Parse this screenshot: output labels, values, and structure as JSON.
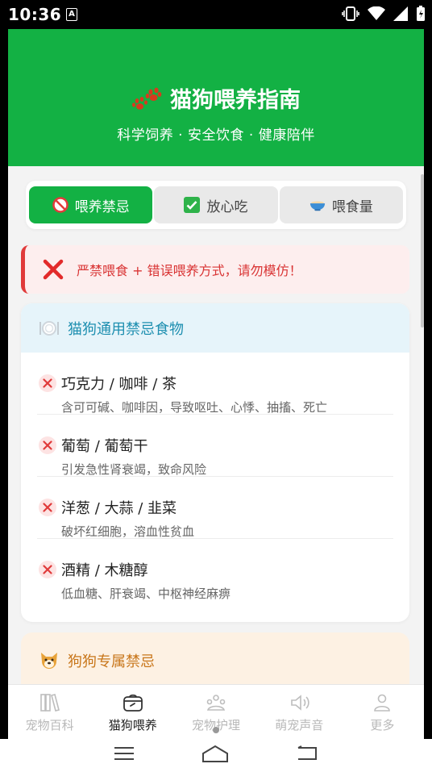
{
  "status": {
    "time": "10:36",
    "notif_letter": "A"
  },
  "header": {
    "title": "猫狗喂养指南",
    "subtitle": "科学饲养 · 安全饮食 · 健康陪伴"
  },
  "tabs": [
    {
      "label": "喂养禁忌",
      "icon": "prohibited-icon",
      "active": true
    },
    {
      "label": "放心吃",
      "icon": "check-box-icon",
      "active": false
    },
    {
      "label": "喂食量",
      "icon": "bowl-icon",
      "active": false
    }
  ],
  "warning": {
    "text": "严禁喂食 + 错误喂养方式，请勿模仿！"
  },
  "card": {
    "title": "猫狗通用禁忌食物",
    "items": [
      {
        "title": "巧克力 / 咖啡 / 茶",
        "desc": "含可可碱、咖啡因，导致呕吐、心悸、抽搐、死亡"
      },
      {
        "title": "葡萄 / 葡萄干",
        "desc": "引发急性肾衰竭，致命风险"
      },
      {
        "title": "洋葱 / 大蒜 / 韭菜",
        "desc": "破坏红细胞，溶血性贫血"
      },
      {
        "title": "酒精 / 木糖醇",
        "desc": "低血糖、肝衰竭、中枢神经麻痹"
      }
    ]
  },
  "card2": {
    "title": "狗狗专属禁忌"
  },
  "bottom_nav": [
    {
      "label": "宠物百科",
      "icon": "books-icon",
      "active": false
    },
    {
      "label": "猫狗喂养",
      "icon": "bowl-nav-icon",
      "active": true
    },
    {
      "label": "宠物护理",
      "icon": "care-icon",
      "active": false
    },
    {
      "label": "萌宠声音",
      "icon": "speaker-icon",
      "active": false
    },
    {
      "label": "更多",
      "icon": "person-icon",
      "active": false
    }
  ],
  "colors": {
    "brand_green": "#13b144",
    "danger_red": "#d93434",
    "info_blue": "#1e8fb0",
    "orange": "#c8761a"
  }
}
